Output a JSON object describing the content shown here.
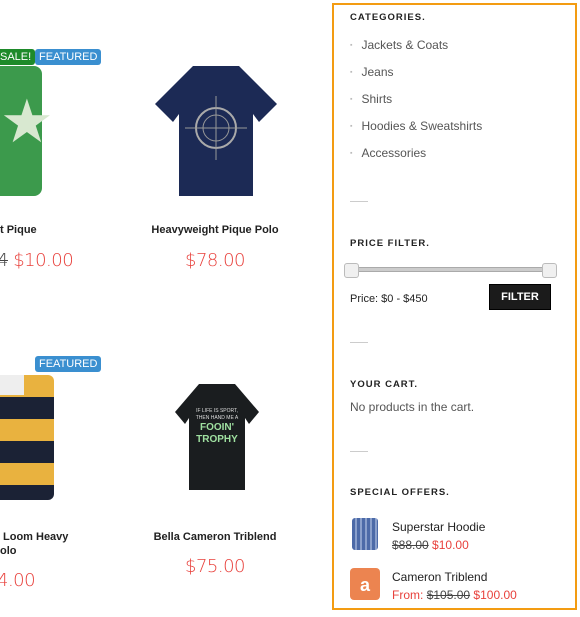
{
  "products": [
    {
      "name": "t Pique",
      "old_price": "4",
      "price": "$10.00",
      "badges": [
        "SALE!",
        "FEATURED"
      ]
    },
    {
      "name": "Heavyweight Pique Polo",
      "price": "$78.00"
    },
    {
      "name_line1": "Loom Heavy",
      "name_line2": "olo",
      "price": "4.00",
      "badges": [
        "FEATURED"
      ]
    },
    {
      "name": "Bella Cameron Triblend",
      "price": "$75.00"
    }
  ],
  "sidebar": {
    "categories_title": "CATEGORIES.",
    "categories": [
      "Jackets & Coats",
      "Jeans",
      "Shirts",
      "Hoodies & Sweatshirts",
      "Accessories"
    ],
    "price_filter_title": "PRICE FILTER.",
    "price_label": "Price: $0 - $450",
    "price_range": {
      "min": 0,
      "max": 450
    },
    "filter_button": "FILTER",
    "cart_title": "YOUR CART.",
    "cart_empty": "No products in the cart.",
    "offers_title": "SPECIAL OFFERS.",
    "offers": [
      {
        "name": "Superstar Hoodie",
        "old_price": "$88.00",
        "price": "$10.00"
      },
      {
        "name": "Cameron Triblend",
        "prefix": "From:",
        "old_price": "$105.00",
        "price": "$100.00"
      }
    ]
  },
  "colors": {
    "accent": "#f39c12",
    "price": "#e8413c",
    "sale": "#1e8a2a",
    "featured": "#3a8fd0"
  }
}
